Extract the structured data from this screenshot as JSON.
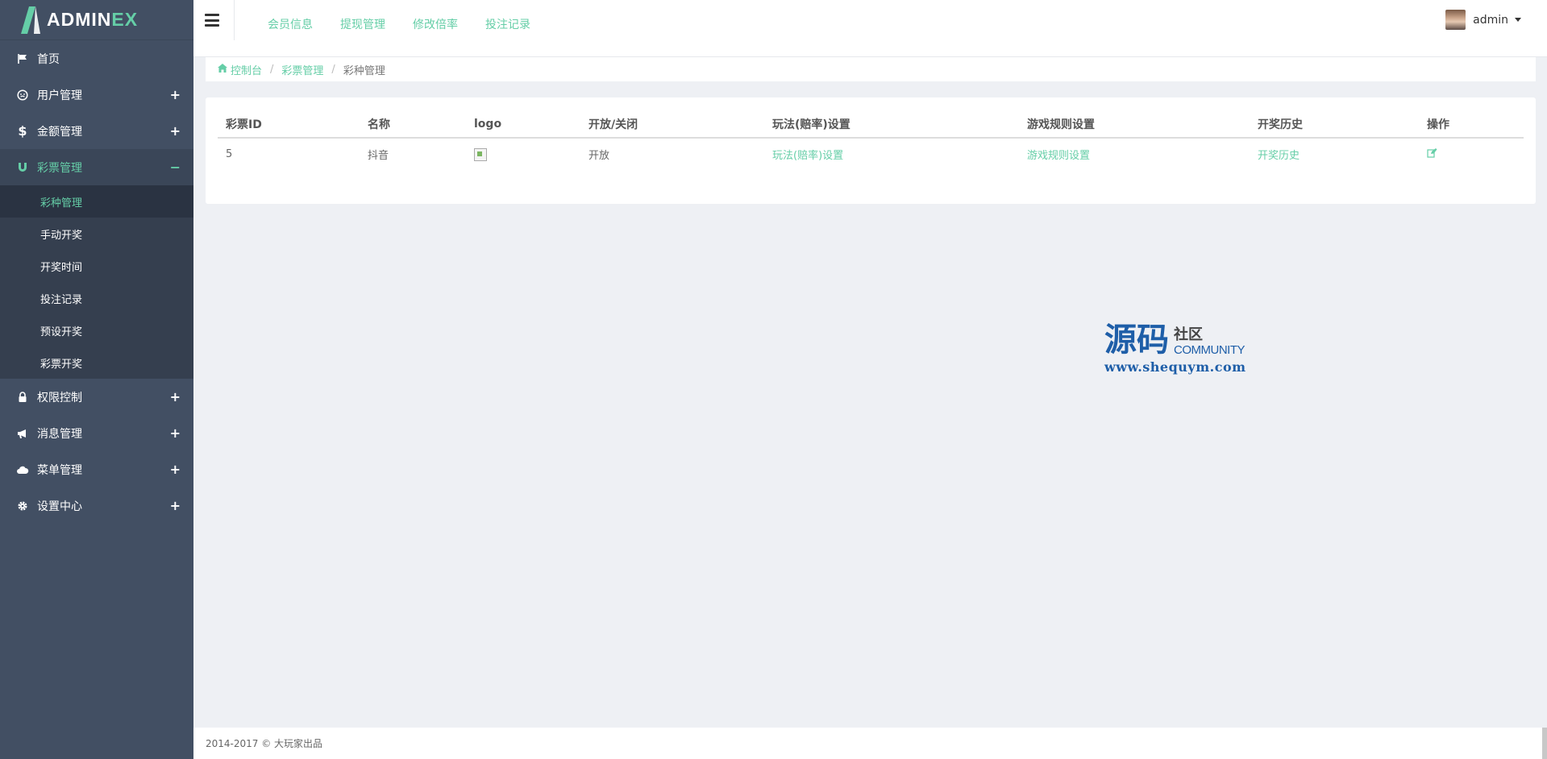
{
  "brand": {
    "main": "ADMIN",
    "accent": "EX",
    "accent_color": "#65cea7"
  },
  "sidebar": {
    "items": [
      {
        "label": "首页",
        "icon": "flag-icon",
        "toggle": ""
      },
      {
        "label": "用户管理",
        "icon": "smile-icon",
        "toggle": "+"
      },
      {
        "label": "金额管理",
        "icon": "dollar-icon",
        "toggle": "+"
      },
      {
        "label": "彩票管理",
        "icon": "magnet-icon",
        "toggle": "−",
        "active": true
      },
      {
        "label": "权限控制",
        "icon": "lock-icon",
        "toggle": "+"
      },
      {
        "label": "消息管理",
        "icon": "bullhorn-icon",
        "toggle": "+"
      },
      {
        "label": "菜单管理",
        "icon": "cloud-icon",
        "toggle": "+"
      },
      {
        "label": "设置中心",
        "icon": "gear-icon",
        "toggle": "+"
      }
    ],
    "submenu": [
      "彩种管理",
      "手动开奖",
      "开奖时间",
      "投注记录",
      "预设开奖",
      "彩票开奖"
    ]
  },
  "header": {
    "menu": [
      "会员信息",
      "提现管理",
      "修改倍率",
      "投注记录"
    ],
    "user": "admin"
  },
  "breadcrumb": {
    "home": "控制台",
    "section": "彩票管理",
    "current": "彩种管理",
    "separator": "/"
  },
  "table": {
    "headers": [
      "彩票ID",
      "名称",
      "logo",
      "开放/关闭",
      "玩法(赔率)设置",
      "游戏规则设置",
      "开奖历史",
      "操作"
    ],
    "rows": [
      {
        "id": "5",
        "name": "抖音",
        "status": "开放",
        "odds_link": "玩法(赔率)设置",
        "rules_link": "游戏规则设置",
        "history_link": "开奖历史"
      }
    ]
  },
  "watermark": {
    "big": "源码",
    "small": "社区",
    "community": "COMMUNITY",
    "url": "www.shequym.com"
  },
  "footer": {
    "text": "2014-2017 © 大玩家出品"
  }
}
